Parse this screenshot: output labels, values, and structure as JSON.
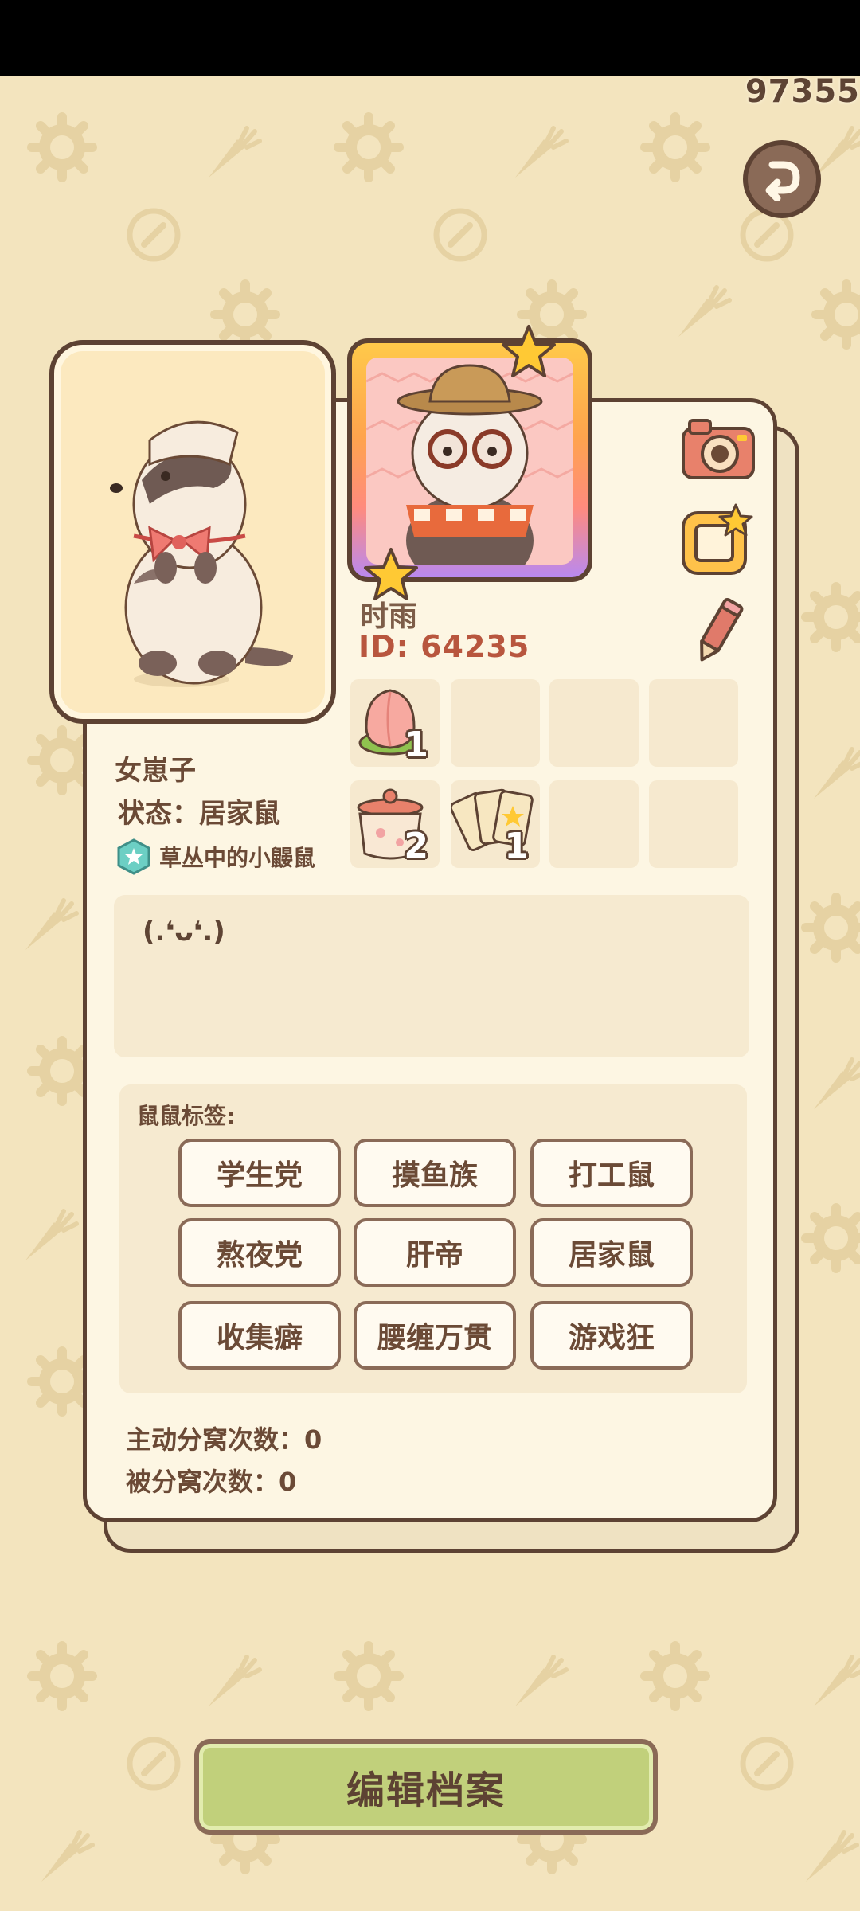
{
  "score": "97355",
  "profile": {
    "name": "时雨",
    "id_text": "ID: 64235",
    "gender_text": "女崽子",
    "status_text": "状态：居家鼠",
    "title_text": "草丛中的小鼹鼠",
    "bio": "(.❛ᴗ❛.)"
  },
  "items": [
    {
      "icon": "peach-icon",
      "count": "1"
    },
    {
      "icon": "",
      "count": ""
    },
    {
      "icon": "",
      "count": ""
    },
    {
      "icon": "",
      "count": ""
    },
    {
      "icon": "cooking-pot-icon",
      "count": "2"
    },
    {
      "icon": "star-cards-icon",
      "count": "1"
    },
    {
      "icon": "",
      "count": ""
    },
    {
      "icon": "",
      "count": ""
    }
  ],
  "tags_label": "鼠鼠标签:",
  "tags": [
    "学生党",
    "摸鱼族",
    "打工鼠",
    "熬夜党",
    "肝帝",
    "居家鼠",
    "收集癖",
    "腰缠万贯",
    "游戏狂"
  ],
  "stats": {
    "active_split": "主动分窝次数：0",
    "passive_split": "被分窝次数：0"
  },
  "edit_button": "编辑档案",
  "colors": {
    "background": "#f3e4be",
    "card": "#fdf6e3",
    "border": "#5d4233",
    "id_color": "#b8563e",
    "edit_button": "#c1d07b"
  }
}
